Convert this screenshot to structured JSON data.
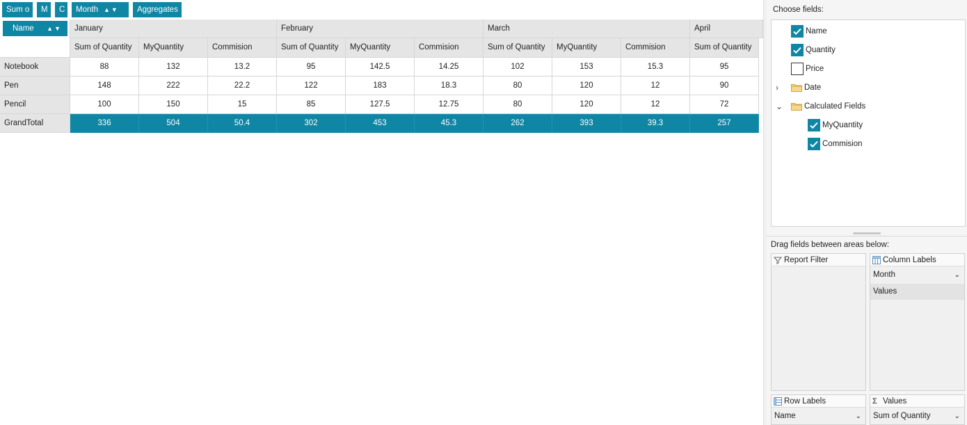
{
  "toolbar": {
    "chips": [
      {
        "label": "Sum o",
        "name": "field-chip-sum"
      },
      {
        "label": "M",
        "name": "field-chip-m"
      },
      {
        "label": "C",
        "name": "field-chip-c"
      },
      {
        "label": "Month",
        "name": "field-chip-month"
      },
      {
        "label": "Aggregates",
        "name": "field-chip-aggregates"
      }
    ]
  },
  "pivot": {
    "row_field": "Name",
    "months": [
      "January",
      "February",
      "March",
      "April"
    ],
    "measures": [
      "Sum of Quantity",
      "MyQuantity",
      "Commision"
    ],
    "rows": [
      {
        "label": "Notebook",
        "values": [
          "88",
          "132",
          "13.2",
          "95",
          "142.5",
          "14.25",
          "102",
          "153",
          "15.3",
          "95"
        ]
      },
      {
        "label": "Pen",
        "values": [
          "148",
          "222",
          "22.2",
          "122",
          "183",
          "18.3",
          "80",
          "120",
          "12",
          "90"
        ]
      },
      {
        "label": "Pencil",
        "values": [
          "100",
          "150",
          "15",
          "85",
          "127.5",
          "12.75",
          "80",
          "120",
          "12",
          "72"
        ]
      }
    ],
    "grand_total": {
      "label": "GrandTotal",
      "values": [
        "336",
        "504",
        "50.4",
        "302",
        "453",
        "45.3",
        "262",
        "393",
        "39.3",
        "257"
      ]
    }
  },
  "field_list": {
    "choose_label": "Choose fields:",
    "fields": [
      {
        "label": "Name",
        "checked": true
      },
      {
        "label": "Quantity",
        "checked": true
      },
      {
        "label": "Price",
        "checked": false
      },
      {
        "label": "Date",
        "folder": true,
        "expanded": false
      },
      {
        "label": "Calculated Fields",
        "folder": true,
        "expanded": true
      },
      {
        "label": "MyQuantity",
        "checked": true,
        "child": true
      },
      {
        "label": "Commision",
        "checked": true,
        "child": true
      }
    ],
    "drag_label": "Drag fields between areas below:",
    "areas": {
      "report_filter": {
        "title": "Report Filter",
        "items": []
      },
      "column_labels": {
        "title": "Column Labels",
        "items": [
          "Month",
          "Values"
        ]
      },
      "row_labels": {
        "title": "Row Labels",
        "items": [
          "Name"
        ]
      },
      "values": {
        "title": "Values",
        "items": [
          "Sum of Quantity"
        ]
      }
    }
  },
  "colors": {
    "accent": "#0f86a4",
    "header_bg": "#e5e5e5",
    "panel_bg": "#f5f5f5"
  }
}
